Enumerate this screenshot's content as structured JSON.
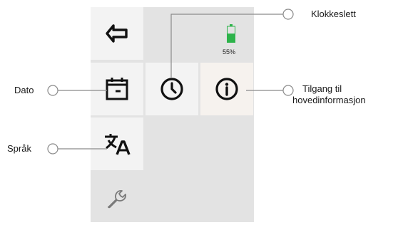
{
  "icons": {
    "back": "back-arrow-icon",
    "calendar": "calendar-icon",
    "clock": "clock-icon",
    "info": "info-icon",
    "translate": "translate-icon",
    "wrench": "wrench-icon",
    "battery": "battery-icon"
  },
  "status": {
    "battery_percent": "55%",
    "battery_level": 0.55,
    "battery_color": "#2db34a"
  },
  "labels": {
    "clock": "Klokkeslett",
    "date": "Dato",
    "info_line1": "Tilgang til",
    "info_line2": "hovedinformasjon",
    "language": "Språk"
  },
  "colors": {
    "panel": "#e3e3e3",
    "tile": "#f3f3f3",
    "line": "#8a8a8a",
    "icon": "#111111"
  }
}
